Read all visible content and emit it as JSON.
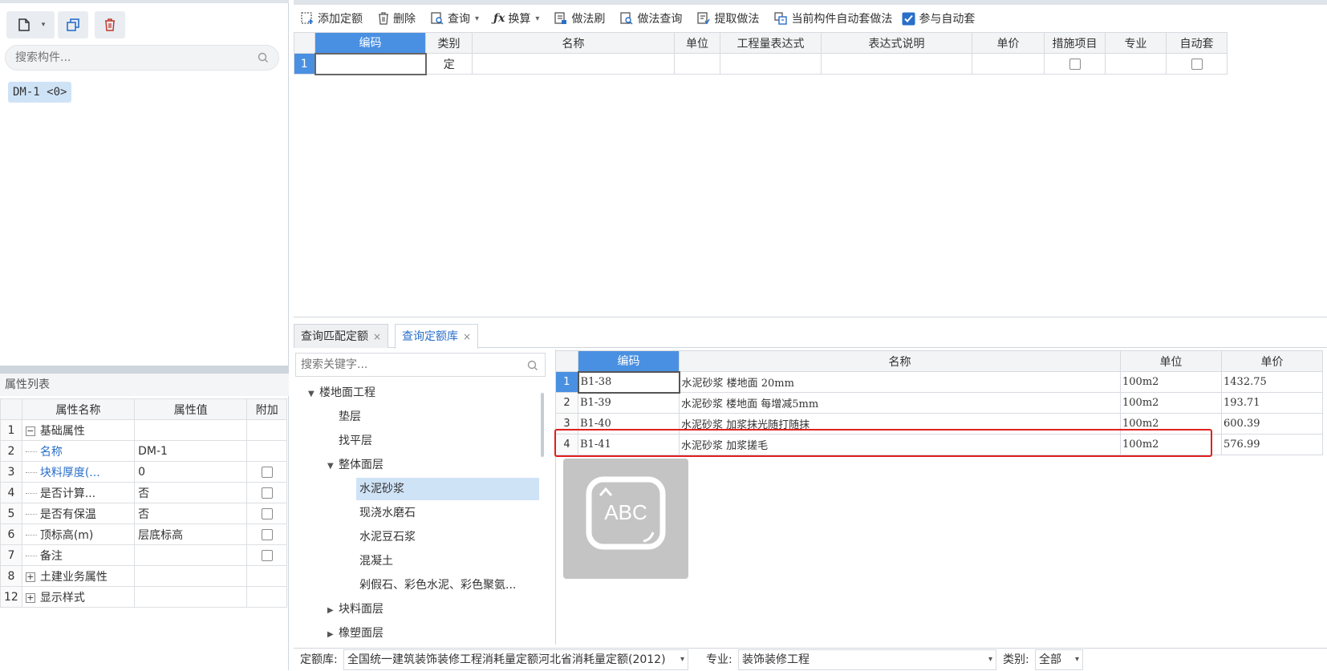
{
  "left": {
    "search_placeholder": "搜索构件...",
    "component_chip": "DM-1 <0>",
    "props_title": "属性列表",
    "props_headers": [
      "属性名称",
      "属性值",
      "附加"
    ],
    "props_rows": [
      {
        "num": "1",
        "name": "基础属性",
        "value": "",
        "type": "group"
      },
      {
        "num": "2",
        "name": "名称",
        "value": "DM-1",
        "type": "blue"
      },
      {
        "num": "3",
        "name": "块料厚度(...",
        "value": "0",
        "type": "blue"
      },
      {
        "num": "4",
        "name": "是否计算...",
        "value": "否",
        "type": "normal"
      },
      {
        "num": "5",
        "name": "是否有保温",
        "value": "否",
        "type": "normal"
      },
      {
        "num": "6",
        "name": "顶标高(m)",
        "value": "层底标高",
        "type": "normal"
      },
      {
        "num": "7",
        "name": "备注",
        "value": "",
        "type": "normal"
      },
      {
        "num": "8",
        "name": "土建业务属性",
        "value": "",
        "type": "group"
      },
      {
        "num": "12",
        "name": "显示样式",
        "value": "",
        "type": "group"
      }
    ]
  },
  "toolbar": {
    "add_quota": "添加定额",
    "delete": "删除",
    "query": "查询",
    "convert": "换算",
    "method_brush": "做法刷",
    "method_query": "做法查询",
    "extract_method": "提取做法",
    "auto_apply_current": "当前构件自动套做法",
    "participate_auto": "参与自动套"
  },
  "upper_table": {
    "headers": [
      "编码",
      "类别",
      "名称",
      "单位",
      "工程量表达式",
      "表达式说明",
      "单价",
      "措施项目",
      "专业",
      "自动套"
    ],
    "row": {
      "num": "1",
      "code": "",
      "type": "定"
    }
  },
  "tabs": {
    "match": "查询匹配定额",
    "library": "查询定额库"
  },
  "lib_search_placeholder": "搜索关键字...",
  "tree": {
    "floor": "楼地面工程",
    "cushion": "垫层",
    "leveling": "找平层",
    "integral": "整体面层",
    "cement_mortar": "水泥砂浆",
    "terrazzo": "现浇水磨石",
    "cement_pebble": "水泥豆石浆",
    "concrete": "混凝土",
    "granite": "剁假石、彩色水泥、彩色聚氨...",
    "block": "块料面层",
    "rubber": "橡塑面层"
  },
  "lib_table": {
    "headers": [
      "编码",
      "名称",
      "单位",
      "单价"
    ],
    "rows": [
      {
        "num": "1",
        "code": "B1-38",
        "name": "水泥砂浆 楼地面 20mm",
        "unit": "100m2",
        "price": "1432.75"
      },
      {
        "num": "2",
        "code": "B1-39",
        "name": "水泥砂浆 楼地面 每增减5mm",
        "unit": "100m2",
        "price": "193.71"
      },
      {
        "num": "3",
        "code": "B1-40",
        "name": "水泥砂浆 加浆抹光随打随抹",
        "unit": "100m2",
        "price": "600.39"
      },
      {
        "num": "4",
        "code": "B1-41",
        "name": "水泥砂浆 加浆搓毛",
        "unit": "100m2",
        "price": "576.99"
      }
    ]
  },
  "ime_badge": "ABC",
  "bottom": {
    "lib_label": "定额库:",
    "lib_value": "全国统一建筑装饰装修工程消耗量定额河北省消耗量定额(2012)",
    "major_label": "专业:",
    "major_value": "装饰装修工程",
    "category_label": "类别:",
    "category_value": "全部"
  }
}
